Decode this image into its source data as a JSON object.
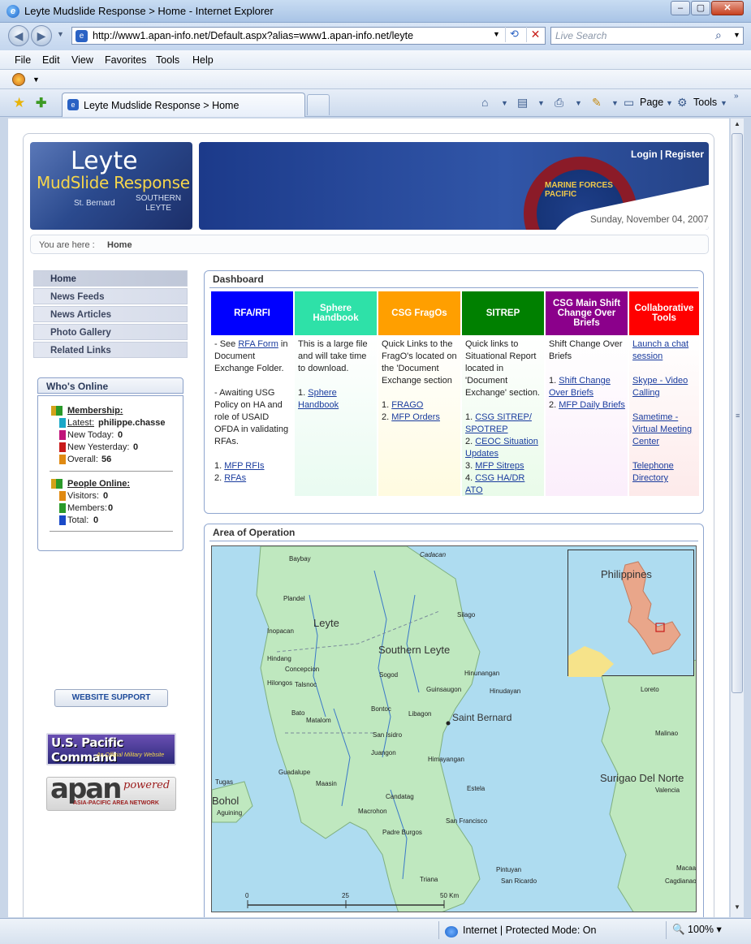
{
  "browser": {
    "window_title": "Leyte Mudslide Response > Home - Internet Explorer",
    "url": "http://www1.apan-info.net/Default.aspx?alias=www1.apan-info.net/leyte",
    "search_placeholder": "Live Search",
    "menu": [
      "File",
      "Edit",
      "View",
      "Favorites",
      "Tools",
      "Help"
    ],
    "tab_title": "Leyte Mudslide Response > Home",
    "commands": {
      "page": "Page",
      "tools": "Tools"
    },
    "status_zone": "Internet | Protected Mode: On",
    "zoom": "100%"
  },
  "site": {
    "logo": {
      "line1": "Leyte",
      "line2": "MudSlide Response",
      "line3": "St. Bernard",
      "line4a": "SOUTHERN",
      "line4b": "LEYTE"
    },
    "seal_text": "MARINE FORCES PACIFIC",
    "login": "Login",
    "separator": "|",
    "register": "Register",
    "date": "Sunday, November 04, 2007",
    "breadcrumb": {
      "label": "You are here :",
      "current": "Home"
    }
  },
  "nav": [
    "Home",
    "News Feeds",
    "News Articles",
    "Photo Gallery",
    "Related Links"
  ],
  "whos_online": {
    "title": "Who's Online",
    "membership_label": "Membership:",
    "latest_label": "Latest:",
    "latest_value": "philippe.chasse",
    "new_today_label": "New Today:",
    "new_today": "0",
    "new_yesterday_label": "New Yesterday:",
    "new_yesterday": "0",
    "overall_label": "Overall:",
    "overall": "56",
    "people_online_label": "People Online:",
    "visitors_label": "Visitors:",
    "visitors": "0",
    "members_label": "Members:",
    "members": "0",
    "total_label": "Total:",
    "total": "0"
  },
  "support_button": "WEBSITE SUPPORT",
  "pacom": {
    "title": "U.S. Pacific Command",
    "sub": "An Official Military Website"
  },
  "apan": {
    "title": "apan",
    "powered": "powered",
    "sub": "ASIA-PACIFIC AREA NETWORK"
  },
  "dashboard": {
    "title": "Dashboard",
    "columns": [
      {
        "header": "RFA/RFI",
        "color": "#0000ff",
        "bg": "#ffffff",
        "p1_pre": "- See ",
        "p1_link": "RFA Form",
        "p1_post": " in Document Exchange Folder.",
        "p2": "- Awaiting USG Policy on HA and role of USAID OFDA in validating RFAs.",
        "list": [
          "MFP RFIs",
          "RFAs"
        ]
      },
      {
        "header": "Sphere Handbook",
        "color": "#2ee1a8",
        "bg": "#e9fbf1",
        "p1": "This is a large file and will take time to download.",
        "list": [
          "Sphere Handbook"
        ]
      },
      {
        "header": "CSG FragOs",
        "color": "#ff9f00",
        "bg": "#fffbe0",
        "p1": "Quick Links to the FragO's located on the 'Document Exchange section",
        "list": [
          "FRAGO",
          "MFP Orders"
        ]
      },
      {
        "header": "SITREP",
        "color": "#008000",
        "bg": "#e9fbe9",
        "p1": "Quick links to Situational Report located in 'Document Exchange' section.",
        "list": [
          "CSG SITREP/ SPOTREP",
          "CEOC Situation Updates",
          "MFP Sitreps",
          "CSG HA/DR ATO"
        ]
      },
      {
        "header": "CSG Main Shift Change Over Briefs",
        "color": "#8b008b",
        "bg": "#fbeefb",
        "p1": "Shift Change Over Briefs",
        "list": [
          "Shift Change Over Briefs",
          "MFP Daily Briefs"
        ]
      },
      {
        "header": "Collaborative Tools",
        "color": "#ff0000",
        "bg": "#fdeaea",
        "links": [
          "Launch a chat session",
          "Skype - Video Calling",
          "Sametime - Virtual Meeting Center",
          "Telephone Directory"
        ]
      }
    ]
  },
  "area_of_operation": {
    "title": "Area of Operation",
    "regions": [
      "Leyte",
      "Southern Leyte",
      "Bohol",
      "Surigao Del Norte",
      "Philippines"
    ],
    "places": [
      "Baybay",
      "Plandel",
      "Inopacan",
      "Hindang",
      "Concepcion",
      "Hilongos",
      "Talsnoc",
      "Bato",
      "Matalom",
      "Guadalupe",
      "Tugas",
      "Aguining",
      "Maasin",
      "Sogod",
      "Bontoc",
      "Libagon",
      "Guinsaugon",
      "Hinunangan",
      "Hinudayan",
      "Silago",
      "Cadacan",
      "San Isidro",
      "Juangon",
      "Himayangan",
      "Candatag",
      "Macrohon",
      "Padre Burgos",
      "Estela",
      "San Francisco",
      "Pintuyan",
      "San Ricardo",
      "Triana",
      "Loreto",
      "Malinao",
      "Valencia",
      "Cagdianao",
      "Macaas",
      "Saint Bernard"
    ],
    "scale": [
      "0",
      "25",
      "50 Km"
    ]
  }
}
